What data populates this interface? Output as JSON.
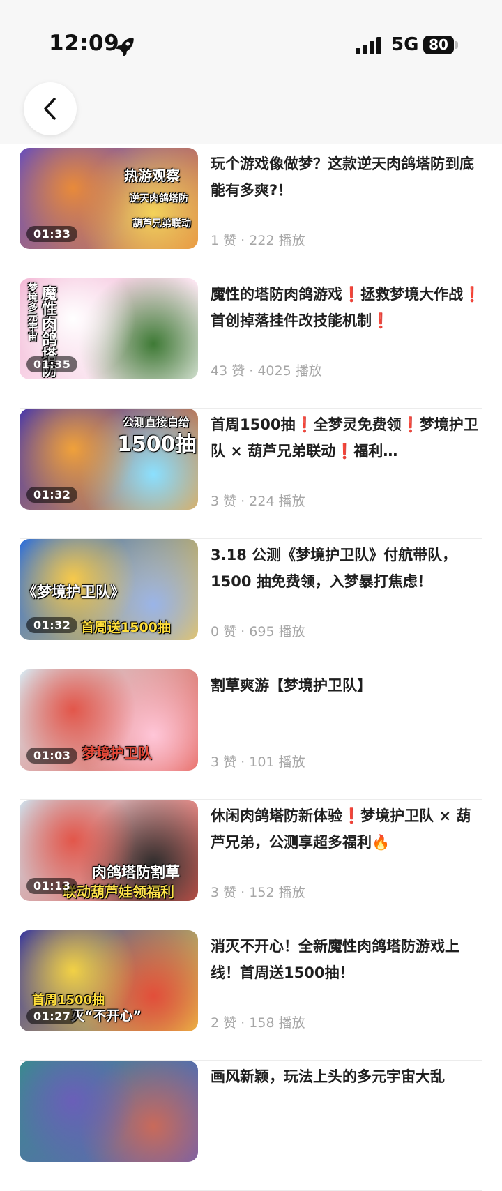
{
  "status_bar": {
    "time": "12:09",
    "network": "5G",
    "battery": "80"
  },
  "videos": [
    {
      "title": "玩个游戏像做梦？这款逆天肉鸽塔防到底能有多爽?！",
      "duration": "01:33",
      "likes": "1 赞",
      "plays": "222 播放",
      "overlay": [
        "热游观察",
        "逆天肉鸽塔防",
        "葫芦兄弟联动"
      ],
      "colors": [
        "#6a4fb8",
        "#e88a3a",
        "#f3d25a"
      ]
    },
    {
      "title": "魔性的塔防肉鸽游戏❗拯救梦境大作战❗首创掉落挂件改技能机制❗",
      "duration": "01:35",
      "likes": "43 赞",
      "plays": "4025 播放",
      "overlay": [
        "梦境多元宇宙",
        "魔性肉鸽塔防"
      ],
      "colors": [
        "#f3b8d6",
        "#ffffff",
        "#3e7a35"
      ]
    },
    {
      "title": "首周1500抽❗全梦灵免费领❗梦境护卫队 × 葫芦兄弟联动❗福利…",
      "duration": "01:32",
      "likes": "3 赞",
      "plays": "224 播放",
      "overlay": [
        "公测直接白给",
        "1500抽"
      ],
      "colors": [
        "#4b3aa8",
        "#f0a13a",
        "#8be0ff"
      ]
    },
    {
      "title": "3.18 公测《梦境护卫队》付航带队，1500 抽免费领，入梦暴打焦虑！",
      "duration": "01:32",
      "likes": "0 赞",
      "plays": "695 播放",
      "overlay": [
        "《梦境护卫队》",
        "首周送1500抽"
      ],
      "colors": [
        "#2f6fd8",
        "#f7c94a",
        "#9ab4e8"
      ]
    },
    {
      "title": "割草爽游【梦境护卫队】",
      "duration": "01:03",
      "likes": "3 赞",
      "plays": "101 播放",
      "overlay": [
        "梦境护卫队"
      ],
      "colors": [
        "#d8e6ee",
        "#e2564a",
        "#ffc6d8"
      ]
    },
    {
      "title": "休闲肉鸽塔防新体验❗梦境护卫队 × 葫芦兄弟，公测享超多福利🔥",
      "duration": "01:13",
      "likes": "3 赞",
      "plays": "152 播放",
      "overlay": [
        "肉鸽塔防割草",
        "联动葫芦娃领福利"
      ],
      "colors": [
        "#cfdde8",
        "#e2564a",
        "#2b2b2b"
      ]
    },
    {
      "title": "消灭不开心！全新魔性肉鸽塔防游戏上线！首周送1500抽！",
      "duration": "01:27",
      "likes": "2 赞",
      "plays": "158 播放",
      "overlay": [
        "首周1500抽",
        "灭“不开心”"
      ],
      "colors": [
        "#3b3a9c",
        "#f2d145",
        "#e24e3a"
      ]
    },
    {
      "title": "画风新颖，玩法上头的多元宇宙大乱",
      "duration": "",
      "likes": "",
      "plays": "",
      "overlay": [],
      "colors": [
        "#3a8a8f",
        "#6a5fb8",
        "#c96a5a"
      ]
    }
  ]
}
